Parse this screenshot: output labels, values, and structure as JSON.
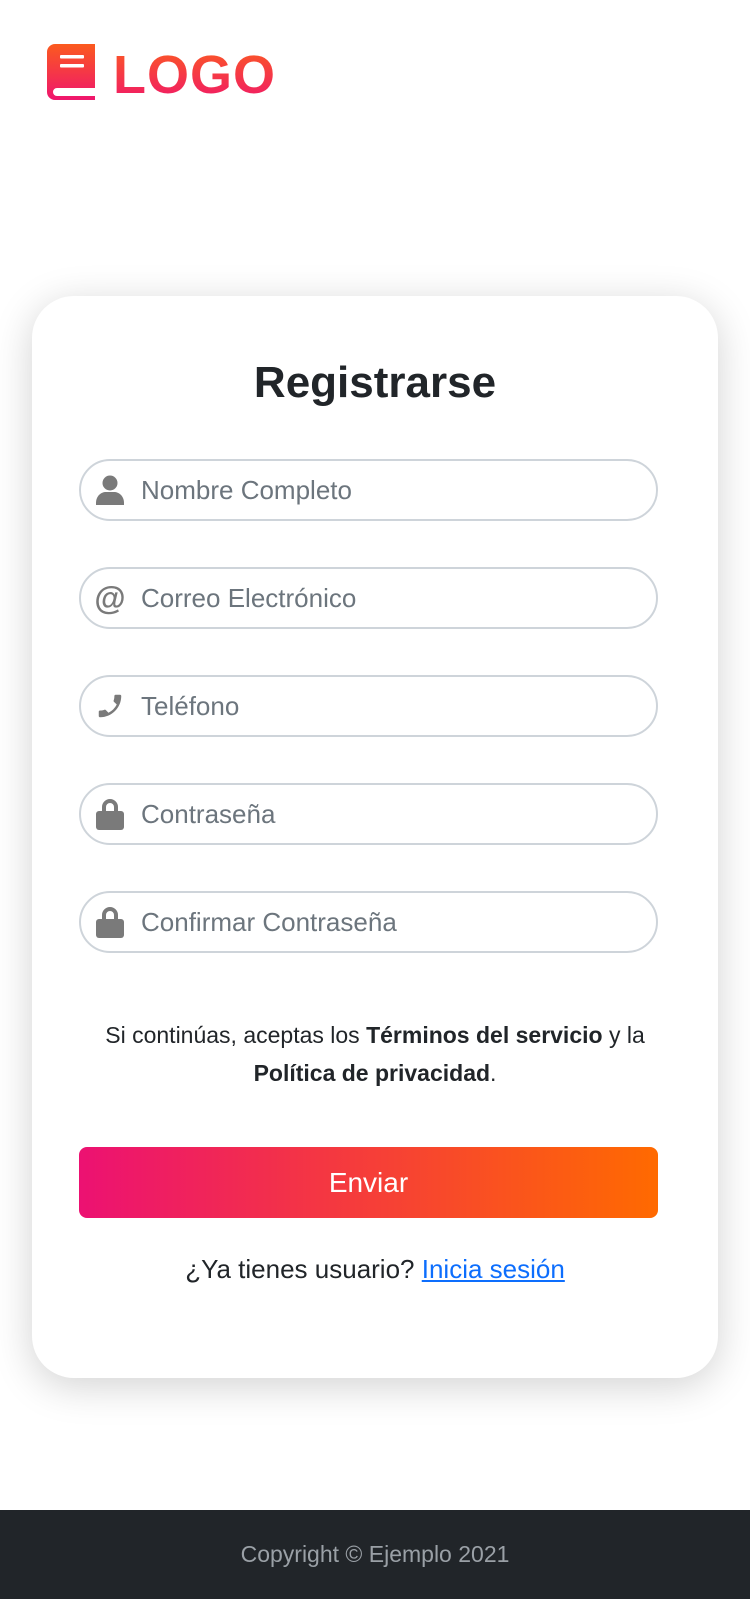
{
  "brand": {
    "logo_text": "LOGO",
    "colors": {
      "gradient_start": "#ec1172",
      "gradient_end": "#ff6a00",
      "link": "#0d6efd"
    }
  },
  "form": {
    "title": "Registrarse",
    "fields": [
      {
        "icon": "user-icon",
        "placeholder": "Nombre Completo",
        "value": ""
      },
      {
        "icon": "at-icon",
        "placeholder": "Correo Electrónico",
        "value": ""
      },
      {
        "icon": "phone-icon",
        "placeholder": "Teléfono",
        "value": ""
      },
      {
        "icon": "lock-icon",
        "placeholder": "Contraseña",
        "value": ""
      },
      {
        "icon": "lock-icon",
        "placeholder": "Confirmar Contraseña",
        "value": ""
      }
    ],
    "terms": {
      "prefix": "Si continúas, aceptas los ",
      "terms_link": "Términos del servicio",
      "middle": " y la ",
      "privacy_link": "Política de privacidad",
      "suffix": "."
    },
    "submit_label": "Enviar",
    "login_prompt": "¿Ya tienes usuario? ",
    "login_link": "Inicia sesión"
  },
  "footer": {
    "text": "Copyright © Ejemplo 2021"
  }
}
